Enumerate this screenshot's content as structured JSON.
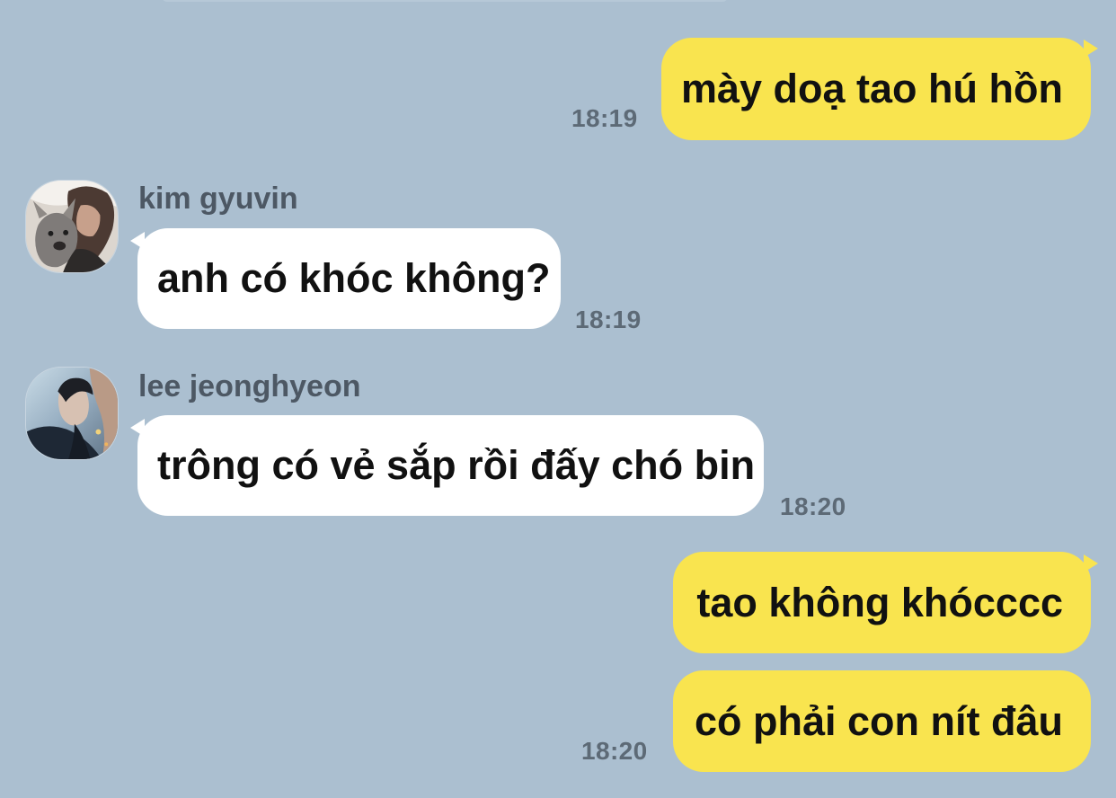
{
  "chat": {
    "messages": [
      {
        "direction": "outgoing",
        "text": "mày doạ tao hú hồn",
        "time": "18:19"
      },
      {
        "direction": "incoming",
        "sender": "kim gyuvin",
        "text": "anh có khóc không?",
        "time": "18:19",
        "avatar_icon": "profile-photo-dog"
      },
      {
        "direction": "incoming",
        "sender": "lee jeonghyeon",
        "text": "trông có vẻ sắp rồi đấy chó bin",
        "time": "18:20",
        "avatar_icon": "profile-photo-person"
      },
      {
        "direction": "outgoing",
        "text": "tao không khócccc",
        "time": ""
      },
      {
        "direction": "outgoing",
        "text": "có phải con nít đâu",
        "time": "18:20"
      }
    ]
  },
  "theme": {
    "background": "#abbfd0",
    "outgoing_bubble": "#f9e44f",
    "incoming_bubble": "#ffffff",
    "timestamp": "#5d6a76",
    "sender_name": "#4d5864"
  }
}
